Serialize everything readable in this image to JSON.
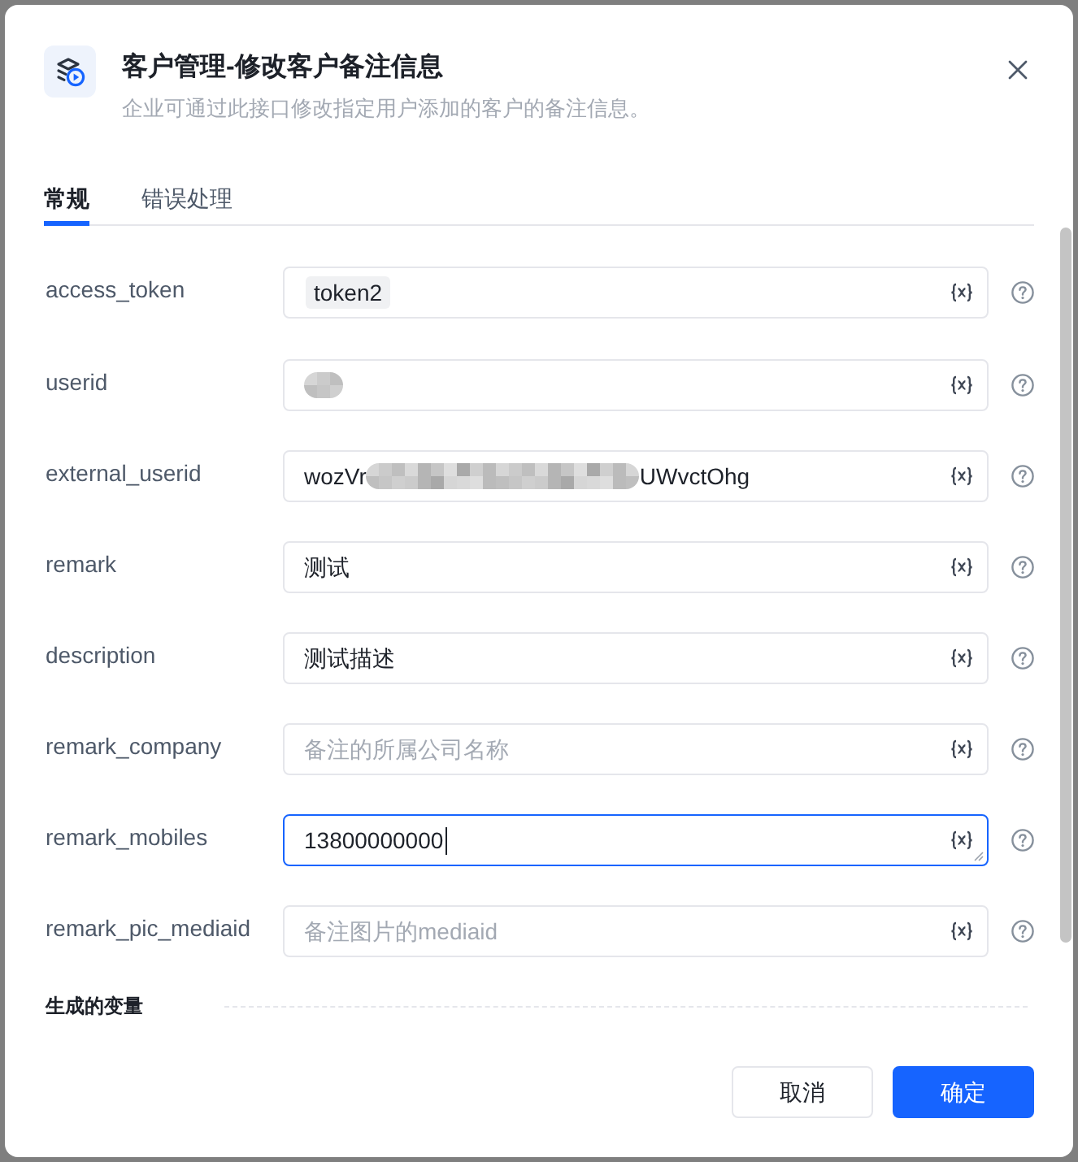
{
  "dialog": {
    "title": "客户管理-修改客户备注信息",
    "subtitle": "企业可通过此接口修改指定用户添加的客户的备注信息。"
  },
  "tabs": [
    {
      "label": "常规",
      "selected": true
    },
    {
      "label": "错误处理",
      "selected": false
    }
  ],
  "fields": [
    {
      "label": "access_token",
      "kind": "tag",
      "value": "token2",
      "focused": false
    },
    {
      "label": "userid",
      "kind": "redacted",
      "focused": false
    },
    {
      "label": "external_userid",
      "kind": "partly_redacted",
      "value_start": "wozVr",
      "value_end": "UWvctOhg",
      "focused": false
    },
    {
      "label": "remark",
      "kind": "text",
      "value": "测试",
      "focused": false
    },
    {
      "label": "description",
      "kind": "text",
      "value": "测试描述",
      "focused": false
    },
    {
      "label": "remark_company",
      "kind": "text",
      "placeholder": "备注的所属公司名称",
      "focused": false
    },
    {
      "label": "remark_mobiles",
      "kind": "text",
      "value": "13800000000",
      "focused": true
    },
    {
      "label": "remark_pic_mediaid",
      "kind": "text",
      "placeholder": "备注图片的mediaid",
      "focused": false
    }
  ],
  "section": {
    "title": "生成的变量"
  },
  "buttons": [
    {
      "label": "取消",
      "kind": "secondary"
    },
    {
      "label": "确定",
      "kind": "primary"
    }
  ]
}
